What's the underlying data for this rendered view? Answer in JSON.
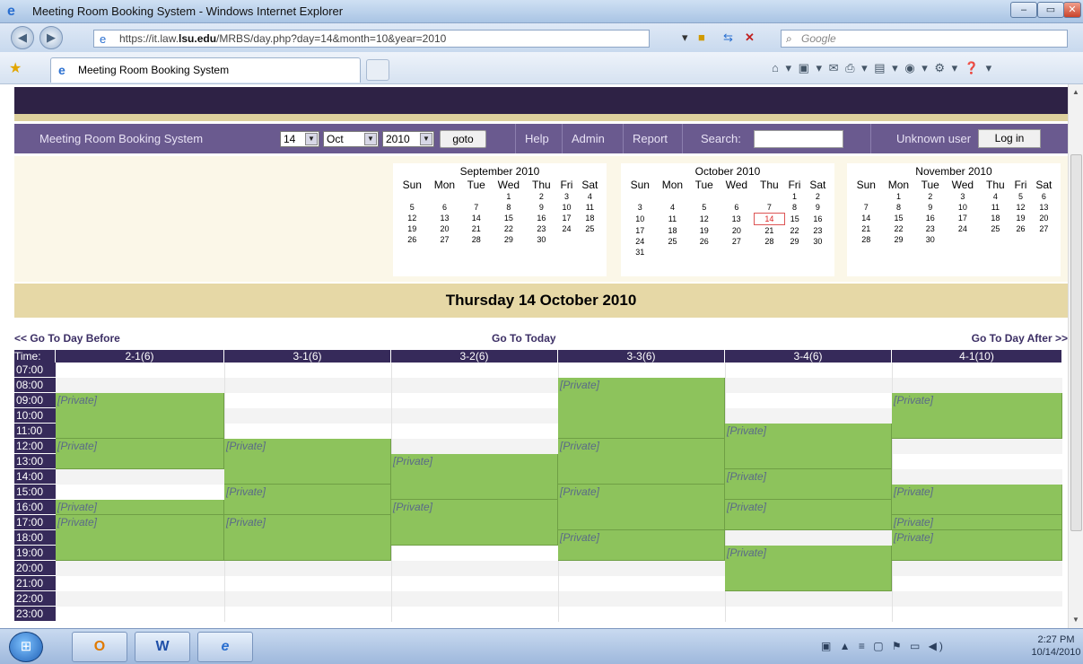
{
  "window": {
    "title": "Meeting Room Booking System - Windows Internet Explorer",
    "controls": [
      "–",
      "▭",
      "✕"
    ]
  },
  "address_bar": {
    "url_prefix": "https://it.law.",
    "url_domain": "lsu.edu",
    "url_path": "/MRBS/day.php?day=14&month=10&year=2010",
    "search_placeholder": "Google"
  },
  "tab": {
    "title": "Meeting Room Booking System"
  },
  "app": {
    "brand": "Meeting Room Booking System",
    "day_select": "14",
    "month_select": "Oct",
    "year_select": "2010",
    "goto_label": "goto",
    "help": "Help",
    "admin": "Admin",
    "report": "Report",
    "search_label": "Search:",
    "user_label": "Unknown user",
    "login_label": "Log in"
  },
  "mini_calendars": [
    {
      "title": "September 2010",
      "today": null,
      "weeks": [
        [
          "",
          "",
          "",
          "1",
          "2",
          "3",
          "4"
        ],
        [
          "5",
          "6",
          "7",
          "8",
          "9",
          "10",
          "11"
        ],
        [
          "12",
          "13",
          "14",
          "15",
          "16",
          "17",
          "18"
        ],
        [
          "19",
          "20",
          "21",
          "22",
          "23",
          "24",
          "25"
        ],
        [
          "26",
          "27",
          "28",
          "29",
          "30",
          "",
          ""
        ]
      ]
    },
    {
      "title": "October 2010",
      "today": "14",
      "weeks": [
        [
          "",
          "",
          "",
          "",
          "",
          "1",
          "2"
        ],
        [
          "3",
          "4",
          "5",
          "6",
          "7",
          "8",
          "9"
        ],
        [
          "10",
          "11",
          "12",
          "13",
          "14",
          "15",
          "16"
        ],
        [
          "17",
          "18",
          "19",
          "20",
          "21",
          "22",
          "23"
        ],
        [
          "24",
          "25",
          "26",
          "27",
          "28",
          "29",
          "30"
        ],
        [
          "31",
          "",
          "",
          "",
          "",
          "",
          ""
        ]
      ]
    },
    {
      "title": "November 2010",
      "today": null,
      "weeks": [
        [
          "",
          "1",
          "2",
          "3",
          "4",
          "5",
          "6"
        ],
        [
          "7",
          "8",
          "9",
          "10",
          "11",
          "12",
          "13"
        ],
        [
          "14",
          "15",
          "16",
          "17",
          "18",
          "19",
          "20"
        ],
        [
          "21",
          "22",
          "23",
          "24",
          "25",
          "26",
          "27"
        ],
        [
          "28",
          "29",
          "30",
          "",
          "",
          "",
          ""
        ]
      ]
    }
  ],
  "weekdays": [
    "Sun",
    "Mon",
    "Tue",
    "Wed",
    "Thu",
    "Fri",
    "Sat"
  ],
  "day_title": "Thursday 14 October 2010",
  "nav": {
    "before": "<< Go To Day Before",
    "today": "Go To Today",
    "after": "Go To Day After >>"
  },
  "grid": {
    "time_header": "Time:",
    "rooms": [
      "2-1(6)",
      "3-1(6)",
      "3-2(6)",
      "3-3(6)",
      "3-4(6)",
      "4-1(10)"
    ],
    "times": [
      "07:00",
      "08:00",
      "09:00",
      "10:00",
      "11:00",
      "12:00",
      "13:00",
      "14:00",
      "15:00",
      "16:00",
      "17:00",
      "18:00",
      "19:00",
      "20:00",
      "21:00",
      "22:00",
      "23:00"
    ],
    "booking_label": "[Private]",
    "bookings": [
      {
        "room": 0,
        "start": 2,
        "rows": 3
      },
      {
        "room": 0,
        "start": 5,
        "rows": 2
      },
      {
        "room": 0,
        "start": 9,
        "rows": 1
      },
      {
        "room": 0,
        "start": 10,
        "rows": 3
      },
      {
        "room": 1,
        "start": 5,
        "rows": 3
      },
      {
        "room": 1,
        "start": 8,
        "rows": 2
      },
      {
        "room": 1,
        "start": 10,
        "rows": 3
      },
      {
        "room": 2,
        "start": 6,
        "rows": 3
      },
      {
        "room": 2,
        "start": 9,
        "rows": 3
      },
      {
        "room": 3,
        "start": 1,
        "rows": 4
      },
      {
        "room": 3,
        "start": 5,
        "rows": 3
      },
      {
        "room": 3,
        "start": 8,
        "rows": 3
      },
      {
        "room": 3,
        "start": 11,
        "rows": 2
      },
      {
        "room": 4,
        "start": 4,
        "rows": 3
      },
      {
        "room": 4,
        "start": 7,
        "rows": 2
      },
      {
        "room": 4,
        "start": 9,
        "rows": 2
      },
      {
        "room": 4,
        "start": 12,
        "rows": 3
      },
      {
        "room": 0,
        "start": 0,
        "rows": 0
      },
      {
        "room": 5,
        "start": 2,
        "rows": 3
      },
      {
        "room": 5,
        "start": 8,
        "rows": 2
      },
      {
        "room": 5,
        "start": 10,
        "rows": 1
      },
      {
        "room": 5,
        "start": 11,
        "rows": 2
      }
    ]
  },
  "taskbar": {
    "apps": [
      "O",
      "W",
      "e"
    ],
    "time": "2:27 PM",
    "date": "10/14/2010"
  }
}
